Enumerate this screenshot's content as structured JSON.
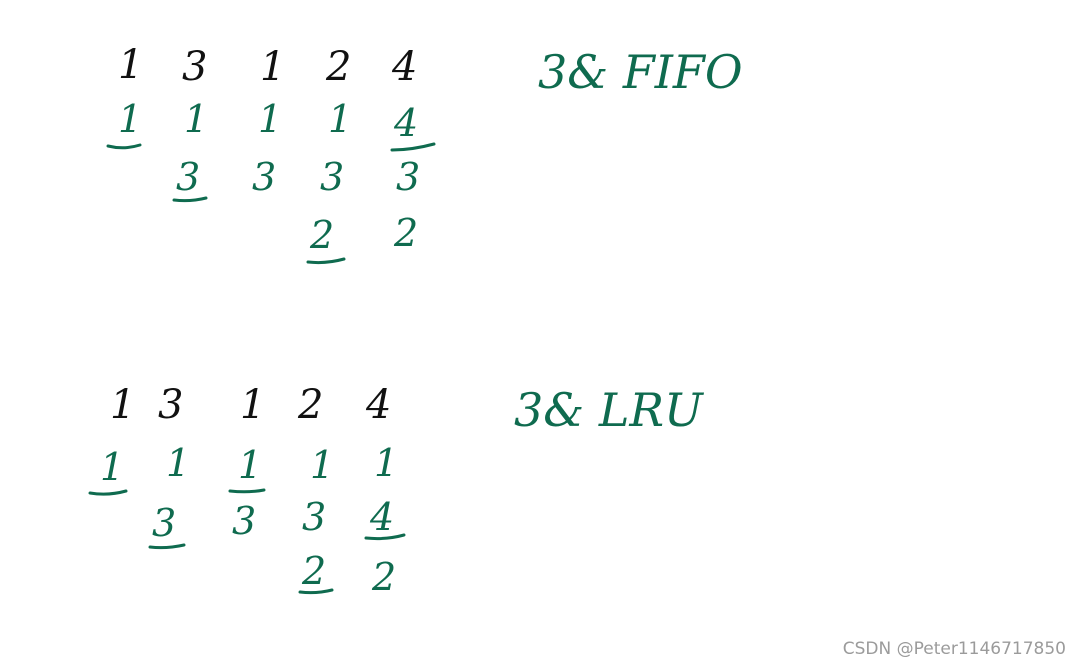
{
  "colors": {
    "ink_black": "#111111",
    "ink_green": "#0f6b4f",
    "watermark": "#9b9b9b"
  },
  "fifo": {
    "title": "3& FIFO",
    "sequence": [
      "1",
      "3",
      "1",
      "2",
      "4"
    ],
    "frames": [
      [
        "1",
        "",
        "",
        ""
      ],
      [
        "1",
        "3",
        "",
        ""
      ],
      [
        "1",
        "3",
        "",
        ""
      ],
      [
        "1",
        "3",
        "2",
        ""
      ],
      [
        "4",
        "3",
        "2",
        ""
      ]
    ]
  },
  "lru": {
    "title": "3& LRU",
    "sequence": [
      "1",
      "3",
      "1",
      "2",
      "4"
    ],
    "frames": [
      [
        "1",
        "",
        "",
        ""
      ],
      [
        "1",
        "3",
        "",
        ""
      ],
      [
        "1",
        "3",
        "",
        ""
      ],
      [
        "1",
        "3",
        "2",
        ""
      ],
      [
        "1",
        "4",
        "2",
        ""
      ]
    ]
  },
  "watermark": "CSDN @Peter1146717850"
}
